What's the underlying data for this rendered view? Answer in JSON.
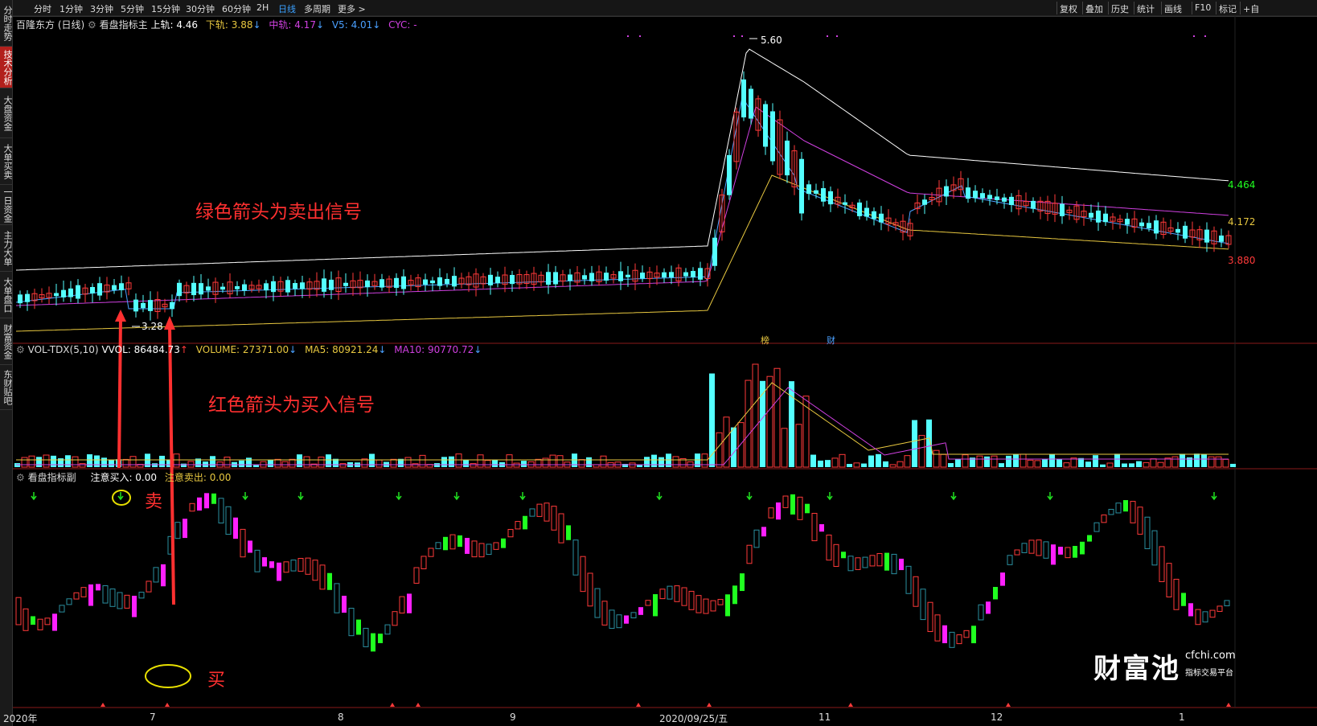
{
  "sidebar": {
    "tabs": [
      {
        "label": "分时走势",
        "active": false
      },
      {
        "label": "技术分析",
        "active": true
      },
      {
        "label": "大盘资金",
        "active": false
      },
      {
        "label": "大单买卖",
        "active": false
      },
      {
        "label": "一日资金",
        "active": false
      },
      {
        "label": "主力大单",
        "active": false
      },
      {
        "label": "大单盘口",
        "active": false
      },
      {
        "label": "财富资金",
        "active": false
      },
      {
        "label": "东财贴吧",
        "active": false
      }
    ]
  },
  "toolbar": {
    "periods": [
      "分时",
      "1分钟",
      "3分钟",
      "5分钟",
      "15分钟",
      "30分钟",
      "60分钟",
      "2H",
      "日线",
      "多周期",
      "更多 >"
    ],
    "active_period": "日线",
    "right_buttons": [
      "复权",
      "叠加",
      "历史",
      "统计",
      "画线",
      "F10",
      "标记",
      "+自"
    ]
  },
  "main_chart": {
    "stock": "百隆东方 (日线)",
    "indicator": "看盘指标主",
    "upper": {
      "label": "上轨:",
      "value": "4.46",
      "color": "#ffffff"
    },
    "lower": {
      "label": "下轨:",
      "value": "3.88",
      "color": "#e8c840"
    },
    "middle": {
      "label": "中轨:",
      "value": "4.17",
      "color": "#d040e0"
    },
    "v5": {
      "label": "V5:",
      "value": "4.01",
      "color": "#4aa0ff"
    },
    "cyc": {
      "label": "CYC:",
      "value": "-",
      "color": "#d040e0"
    },
    "high_label": "5.60",
    "low_label": "3.28",
    "right_prices": {
      "upper": "4.464",
      "middle": "4.172",
      "lower": "3.880"
    },
    "markers": [
      "榜",
      "财"
    ]
  },
  "volume_chart": {
    "title": "VOL-TDX(5,10)",
    "vvol": "VVOL: 86484.73",
    "volume": "VOLUME: 27371.00",
    "ma5": "MA5: 80921.24",
    "ma10": "MA10: 90770.72"
  },
  "sub_chart": {
    "title": "看盘指标副",
    "buy": "注意买入: 0.00",
    "sell": "注意卖出: 0.00"
  },
  "annotations": {
    "green_arrow_note": "绿色箭头为卖出信号",
    "red_arrow_note": "红色箭头为买入信号",
    "sell_mark": "卖",
    "buy_mark": "买"
  },
  "x_axis": [
    "2020年",
    "7",
    "8",
    "9",
    "2020/09/25/五",
    "11",
    "12",
    "1"
  ],
  "watermark": {
    "name": "财富池",
    "url": "cfchi.com",
    "tagline": "指标交易平台"
  },
  "colors": {
    "up": "#ff3a3a",
    "down": "#54ffff",
    "upper": "#ffffff",
    "middle": "#d040e0",
    "lower": "#e8c840",
    "v5": "#4aa0ff",
    "sell_arrow": "#20e020",
    "buy_mark": "#ff3030",
    "magenta": "#ff20ff",
    "green": "#20ff20"
  }
}
